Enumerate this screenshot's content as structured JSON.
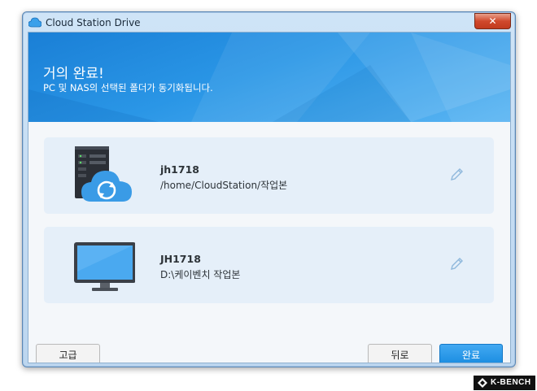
{
  "window": {
    "title": "Cloud Station Drive",
    "close_label": "✕"
  },
  "banner": {
    "title": "거의 완료!",
    "subtitle": "PC 및 NAS의 선택된 폴더가 동기화됩니다."
  },
  "nas": {
    "name": "jh1718",
    "path": "/home/CloudStation/작업본",
    "icon": "nas-sync-icon"
  },
  "pc": {
    "name": "JH1718",
    "path": "D:\\케이벤치 작업본",
    "icon": "monitor-icon"
  },
  "buttons": {
    "advanced": "고급",
    "back": "뒤로",
    "finish": "완료"
  },
  "watermark": {
    "text": "K-BENCH"
  },
  "colors": {
    "accent": "#1a8ce0",
    "banner": "#2a96e6",
    "card": "#e5eff9"
  }
}
